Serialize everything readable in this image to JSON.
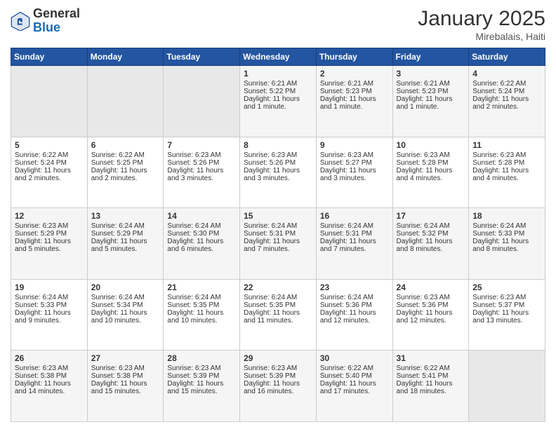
{
  "logo": {
    "general": "General",
    "blue": "Blue"
  },
  "header": {
    "month": "January 2025",
    "location": "Mirebalais, Haiti"
  },
  "days_of_week": [
    "Sunday",
    "Monday",
    "Tuesday",
    "Wednesday",
    "Thursday",
    "Friday",
    "Saturday"
  ],
  "weeks": [
    [
      {
        "day": "",
        "empty": true
      },
      {
        "day": "",
        "empty": true
      },
      {
        "day": "",
        "empty": true
      },
      {
        "day": "1",
        "sunrise": "6:21 AM",
        "sunset": "5:22 PM",
        "daylight": "Daylight: 11 hours and 1 minute."
      },
      {
        "day": "2",
        "sunrise": "6:21 AM",
        "sunset": "5:23 PM",
        "daylight": "Daylight: 11 hours and 1 minute."
      },
      {
        "day": "3",
        "sunrise": "6:21 AM",
        "sunset": "5:23 PM",
        "daylight": "Daylight: 11 hours and 1 minute."
      },
      {
        "day": "4",
        "sunrise": "6:22 AM",
        "sunset": "5:24 PM",
        "daylight": "Daylight: 11 hours and 2 minutes."
      }
    ],
    [
      {
        "day": "5",
        "sunrise": "6:22 AM",
        "sunset": "5:24 PM",
        "daylight": "Daylight: 11 hours and 2 minutes."
      },
      {
        "day": "6",
        "sunrise": "6:22 AM",
        "sunset": "5:25 PM",
        "daylight": "Daylight: 11 hours and 2 minutes."
      },
      {
        "day": "7",
        "sunrise": "6:23 AM",
        "sunset": "5:26 PM",
        "daylight": "Daylight: 11 hours and 3 minutes."
      },
      {
        "day": "8",
        "sunrise": "6:23 AM",
        "sunset": "5:26 PM",
        "daylight": "Daylight: 11 hours and 3 minutes."
      },
      {
        "day": "9",
        "sunrise": "6:23 AM",
        "sunset": "5:27 PM",
        "daylight": "Daylight: 11 hours and 3 minutes."
      },
      {
        "day": "10",
        "sunrise": "6:23 AM",
        "sunset": "5:28 PM",
        "daylight": "Daylight: 11 hours and 4 minutes."
      },
      {
        "day": "11",
        "sunrise": "6:23 AM",
        "sunset": "5:28 PM",
        "daylight": "Daylight: 11 hours and 4 minutes."
      }
    ],
    [
      {
        "day": "12",
        "sunrise": "6:23 AM",
        "sunset": "5:29 PM",
        "daylight": "Daylight: 11 hours and 5 minutes."
      },
      {
        "day": "13",
        "sunrise": "6:24 AM",
        "sunset": "5:29 PM",
        "daylight": "Daylight: 11 hours and 5 minutes."
      },
      {
        "day": "14",
        "sunrise": "6:24 AM",
        "sunset": "5:30 PM",
        "daylight": "Daylight: 11 hours and 6 minutes."
      },
      {
        "day": "15",
        "sunrise": "6:24 AM",
        "sunset": "5:31 PM",
        "daylight": "Daylight: 11 hours and 7 minutes."
      },
      {
        "day": "16",
        "sunrise": "6:24 AM",
        "sunset": "5:31 PM",
        "daylight": "Daylight: 11 hours and 7 minutes."
      },
      {
        "day": "17",
        "sunrise": "6:24 AM",
        "sunset": "5:32 PM",
        "daylight": "Daylight: 11 hours and 8 minutes."
      },
      {
        "day": "18",
        "sunrise": "6:24 AM",
        "sunset": "5:33 PM",
        "daylight": "Daylight: 11 hours and 8 minutes."
      }
    ],
    [
      {
        "day": "19",
        "sunrise": "6:24 AM",
        "sunset": "5:33 PM",
        "daylight": "Daylight: 11 hours and 9 minutes."
      },
      {
        "day": "20",
        "sunrise": "6:24 AM",
        "sunset": "5:34 PM",
        "daylight": "Daylight: 11 hours and 10 minutes."
      },
      {
        "day": "21",
        "sunrise": "6:24 AM",
        "sunset": "5:35 PM",
        "daylight": "Daylight: 11 hours and 10 minutes."
      },
      {
        "day": "22",
        "sunrise": "6:24 AM",
        "sunset": "5:35 PM",
        "daylight": "Daylight: 11 hours and 11 minutes."
      },
      {
        "day": "23",
        "sunrise": "6:24 AM",
        "sunset": "5:36 PM",
        "daylight": "Daylight: 11 hours and 12 minutes."
      },
      {
        "day": "24",
        "sunrise": "6:23 AM",
        "sunset": "5:36 PM",
        "daylight": "Daylight: 11 hours and 12 minutes."
      },
      {
        "day": "25",
        "sunrise": "6:23 AM",
        "sunset": "5:37 PM",
        "daylight": "Daylight: 11 hours and 13 minutes."
      }
    ],
    [
      {
        "day": "26",
        "sunrise": "6:23 AM",
        "sunset": "5:38 PM",
        "daylight": "Daylight: 11 hours and 14 minutes."
      },
      {
        "day": "27",
        "sunrise": "6:23 AM",
        "sunset": "5:38 PM",
        "daylight": "Daylight: 11 hours and 15 minutes."
      },
      {
        "day": "28",
        "sunrise": "6:23 AM",
        "sunset": "5:39 PM",
        "daylight": "Daylight: 11 hours and 15 minutes."
      },
      {
        "day": "29",
        "sunrise": "6:23 AM",
        "sunset": "5:39 PM",
        "daylight": "Daylight: 11 hours and 16 minutes."
      },
      {
        "day": "30",
        "sunrise": "6:22 AM",
        "sunset": "5:40 PM",
        "daylight": "Daylight: 11 hours and 17 minutes."
      },
      {
        "day": "31",
        "sunrise": "6:22 AM",
        "sunset": "5:41 PM",
        "daylight": "Daylight: 11 hours and 18 minutes."
      },
      {
        "day": "",
        "empty": true
      }
    ]
  ]
}
